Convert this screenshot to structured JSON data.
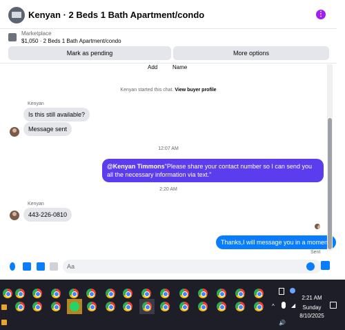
{
  "header": {
    "title": "Kenyan · 2 Beds 1 Bath Apartment/condo",
    "menu_icon": "kebab-menu-icon"
  },
  "listing": {
    "source": "Marketplace",
    "detail": "$1,050 · 2 Beds 1 Bath Apartment/condo"
  },
  "actions": {
    "pending": "Mark as pending",
    "more": "More options"
  },
  "top_strip": {
    "add": "Add",
    "name": "Name"
  },
  "intro": {
    "started": "Kenyan started this chat.",
    "profile_link": "View buyer profile"
  },
  "messages": [
    {
      "sender": "Kenyan",
      "text": "Is this still available?"
    },
    {
      "text": "Message sent"
    },
    {
      "time": "12:07 AM"
    },
    {
      "mention": "@Kenyan Timmons",
      "text": "\"Please share your contact number so I can send you all the necessary information via text.\""
    },
    {
      "time": "2:20 AM"
    },
    {
      "sender": "Kenyan",
      "text": "443-226-0810"
    },
    {
      "text": "Thanks,I will message you in a moment.",
      "status": "Sent"
    }
  ],
  "composer": {
    "placeholder": "Aa",
    "icons": [
      "mic-icon",
      "photo-icon",
      "sticker-icon",
      "gif-icon",
      "emoji-icon",
      "like-icon"
    ]
  },
  "taskbar": {
    "time": "2:21 AM",
    "day": "Sunday",
    "date": "8/10/2025"
  },
  "colors": {
    "outgoing": "#0a7cff",
    "gradient": "#5b3dee",
    "incoming": "#e4e6eb"
  }
}
